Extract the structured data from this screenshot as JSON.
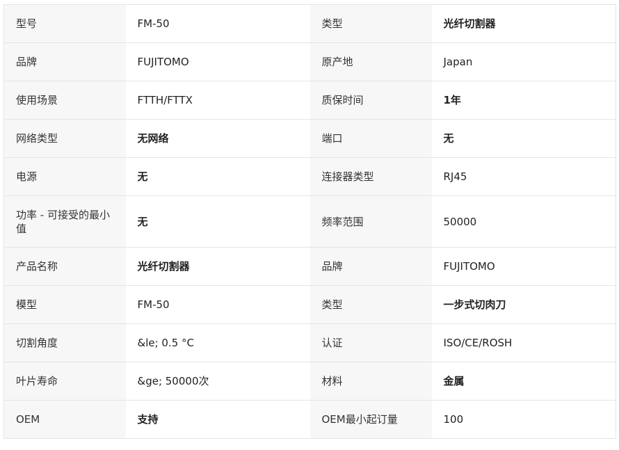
{
  "rows": [
    {
      "label1": "型号",
      "value1": "FM-50",
      "label2": "类型",
      "value2": "光纤切割器"
    },
    {
      "label1": "品牌",
      "value1": "FUJITOMO",
      "label2": "原产地",
      "value2": "Japan"
    },
    {
      "label1": "使用场景",
      "value1": "FTTH/FTTX",
      "label2": "质保时间",
      "value2": "1年"
    },
    {
      "label1": "网络类型",
      "value1": "无网络",
      "label2": "端口",
      "value2": "无"
    },
    {
      "label1": "电源",
      "value1": "无",
      "label2": "连接器类型",
      "value2": "RJ45"
    },
    {
      "label1": "功率 - 可接受的最小值",
      "value1": "无",
      "label2": "频率范围",
      "value2": "50000"
    },
    {
      "label1": "产品名称",
      "value1": "光纤切割器",
      "label2": "品牌",
      "value2": "FUJITOMO"
    },
    {
      "label1": "模型",
      "value1": "FM-50",
      "label2": "类型",
      "value2": "一步式切肉刀"
    },
    {
      "label1": "切割角度",
      "value1": "&le; 0.5 °C",
      "label2": "认证",
      "value2": "ISO/CE/ROSH"
    },
    {
      "label1": "叶片寿命",
      "value1": "&ge; 50000次",
      "label2": "材料",
      "value2": "金属"
    },
    {
      "label1": "OEM",
      "value1": "支持",
      "label2": "OEM最小起订量",
      "value2": "100"
    }
  ]
}
